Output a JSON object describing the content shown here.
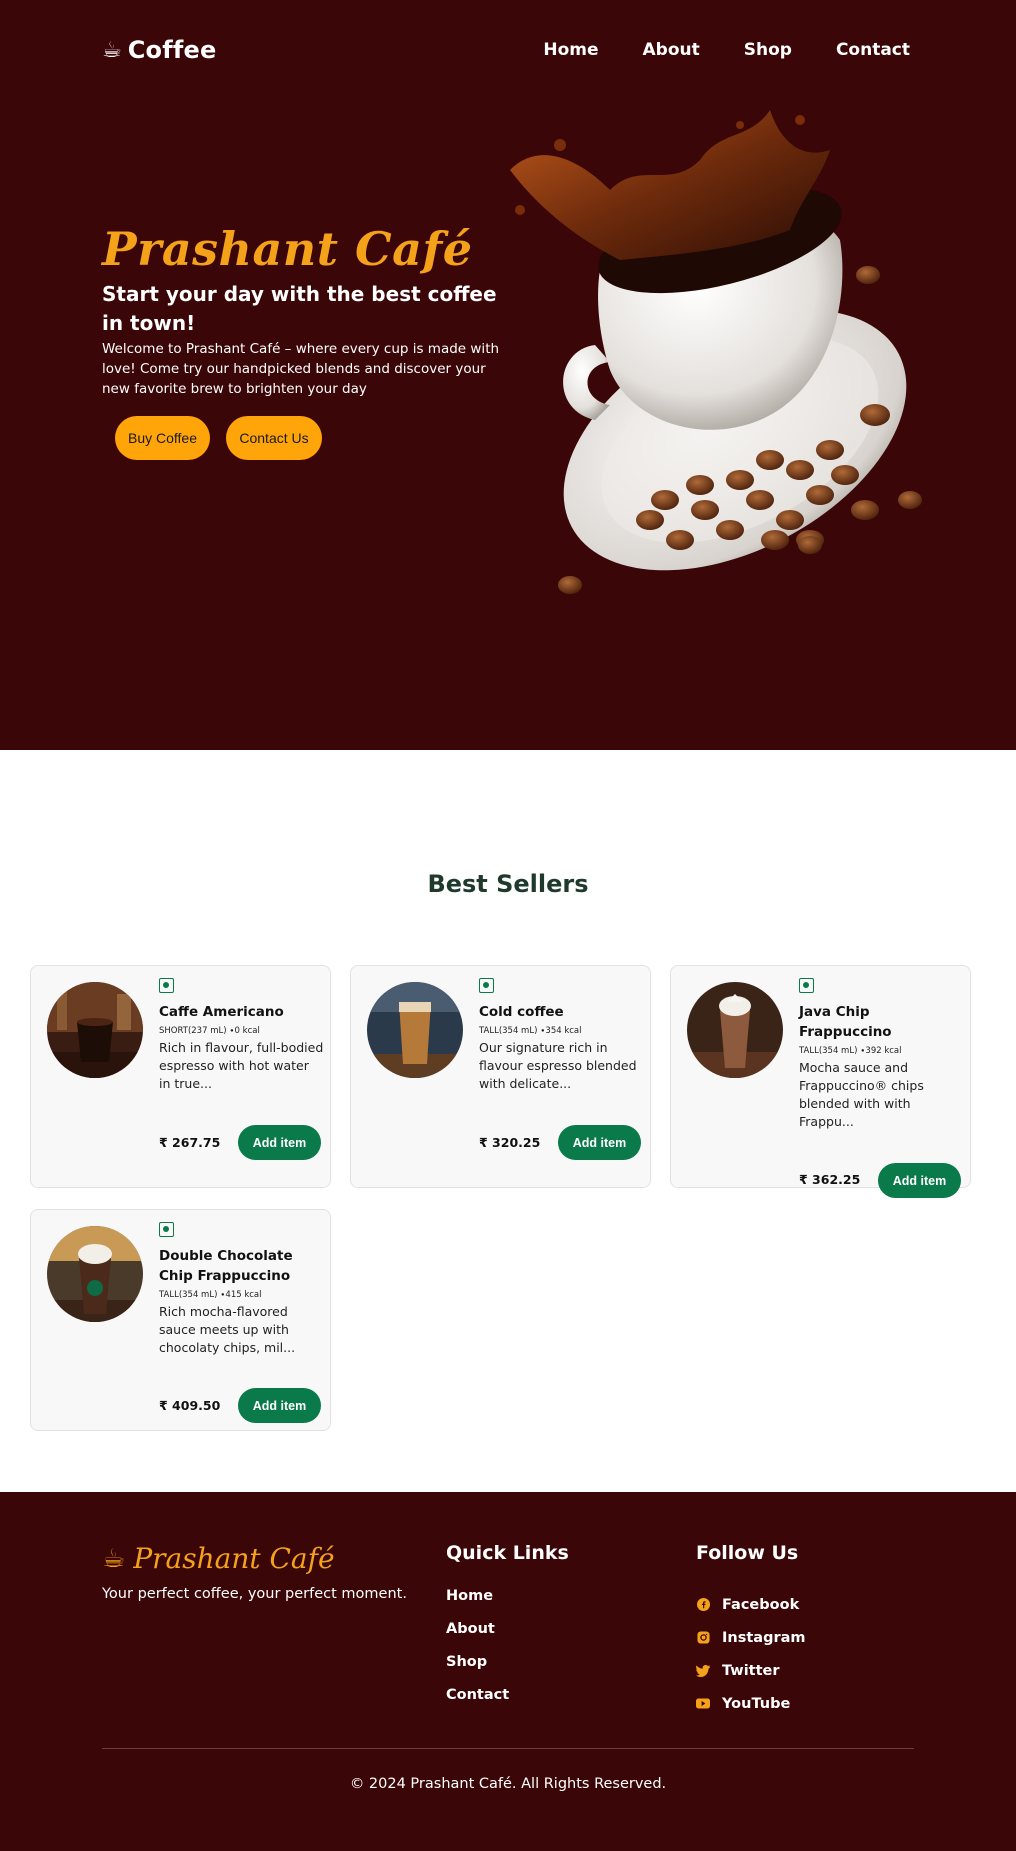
{
  "header": {
    "logo_icon": "coffee-cup-icon",
    "logo_text": "Coffee",
    "nav": [
      "Home",
      "About",
      "Shop",
      "Contact"
    ]
  },
  "hero": {
    "title": "Prashant Café",
    "subtitle": "Start your day with the best coffee in town!",
    "description": "Welcome to Prashant Café – where every cup is made with love! Come try our handpicked blends and discover your new favorite brew to brighten your day",
    "buy_button": "Buy Coffee",
    "contact_button": "Contact Us"
  },
  "best_sellers": {
    "title": "Best Sellers",
    "add_label": "Add item",
    "items": [
      {
        "name": "Caffe Americano",
        "meta": "SHORT(237 mL) ∙0 kcal",
        "desc": "Rich in flavour, full-bodied espresso with hot water in true...",
        "price": "₹ 267.75"
      },
      {
        "name": "Cold coffee",
        "meta": "TALL(354 mL) ∙354 kcal",
        "desc": "Our signature rich in flavour espresso blended with delicate...",
        "price": "₹ 320.25"
      },
      {
        "name": "Java Chip Frappuccino",
        "meta": "TALL(354 mL) ∙392 kcal",
        "desc": "Mocha sauce and Frappuccino® chips blended with with Frappu...",
        "price": "₹ 362.25"
      },
      {
        "name": "Double Chocolate Chip Frappuccino",
        "meta": "TALL(354 mL) ∙415 kcal",
        "desc": "Rich mocha-flavored sauce meets up with chocolaty chips, mil...",
        "price": "₹ 409.50"
      }
    ]
  },
  "footer": {
    "brand": "Prashant Café",
    "tagline": "Your perfect coffee, your perfect moment.",
    "quick_links_title": "Quick Links",
    "quick_links": [
      "Home",
      "About",
      "Shop",
      "Contact"
    ],
    "follow_title": "Follow Us",
    "social": [
      {
        "label": "Facebook",
        "icon": "facebook-icon"
      },
      {
        "label": "Instagram",
        "icon": "instagram-icon"
      },
      {
        "label": "Twitter",
        "icon": "twitter-icon"
      },
      {
        "label": "YouTube",
        "icon": "youtube-icon"
      }
    ],
    "copyright": "© 2024 Prashant Café. All Rights Reserved."
  },
  "colors": {
    "primary_dark": "#3b0607",
    "accent": "#f5a21b",
    "button_yellow": "#ffa50a",
    "add_green": "#0a7a4a",
    "heading_green": "#1f3a2d"
  }
}
